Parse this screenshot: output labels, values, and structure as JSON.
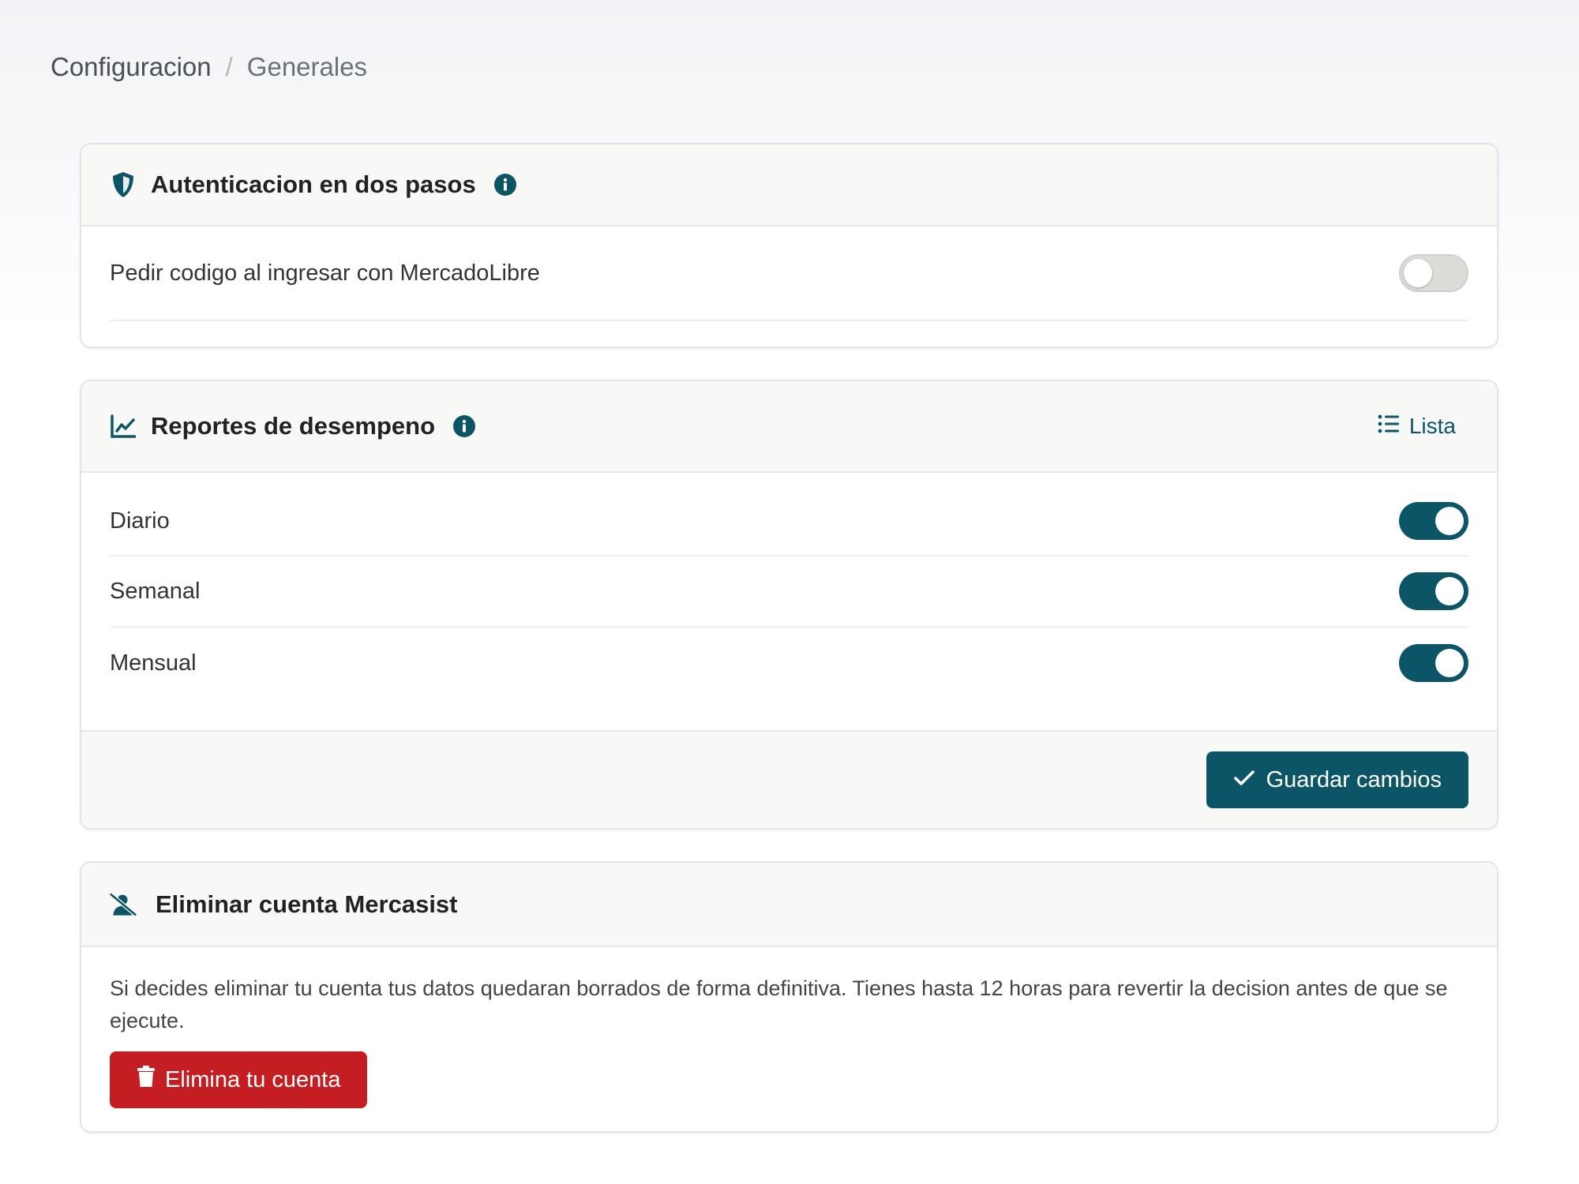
{
  "breadcrumb": {
    "parent": "Configuracion",
    "separator": "/",
    "current": "Generales"
  },
  "two_factor": {
    "title": "Autenticacion en dos pasos",
    "icon": "shield-icon",
    "rows": [
      {
        "label": "Pedir codigo al ingresar con MercadoLibre",
        "enabled": false
      }
    ]
  },
  "reports": {
    "title": "Reportes de desempeno",
    "icon": "chart-line-icon",
    "view_link": "Lista",
    "rows": [
      {
        "label": "Diario",
        "enabled": true
      },
      {
        "label": "Semanal",
        "enabled": true
      },
      {
        "label": "Mensual",
        "enabled": true
      }
    ],
    "save_label": "Guardar cambios"
  },
  "delete_account": {
    "title": "Eliminar cuenta Mercasist",
    "icon": "user-slash-icon",
    "description": "Si decides eliminar tu cuenta tus datos quedaran borrados de forma definitiva. Tienes hasta 12 horas para revertir la decision antes de que se ejecute.",
    "button_label": "Elimina tu cuenta"
  },
  "colors": {
    "accent": "#0c5566",
    "danger": "#c41e23",
    "toggle_off": "#dddcd9"
  }
}
